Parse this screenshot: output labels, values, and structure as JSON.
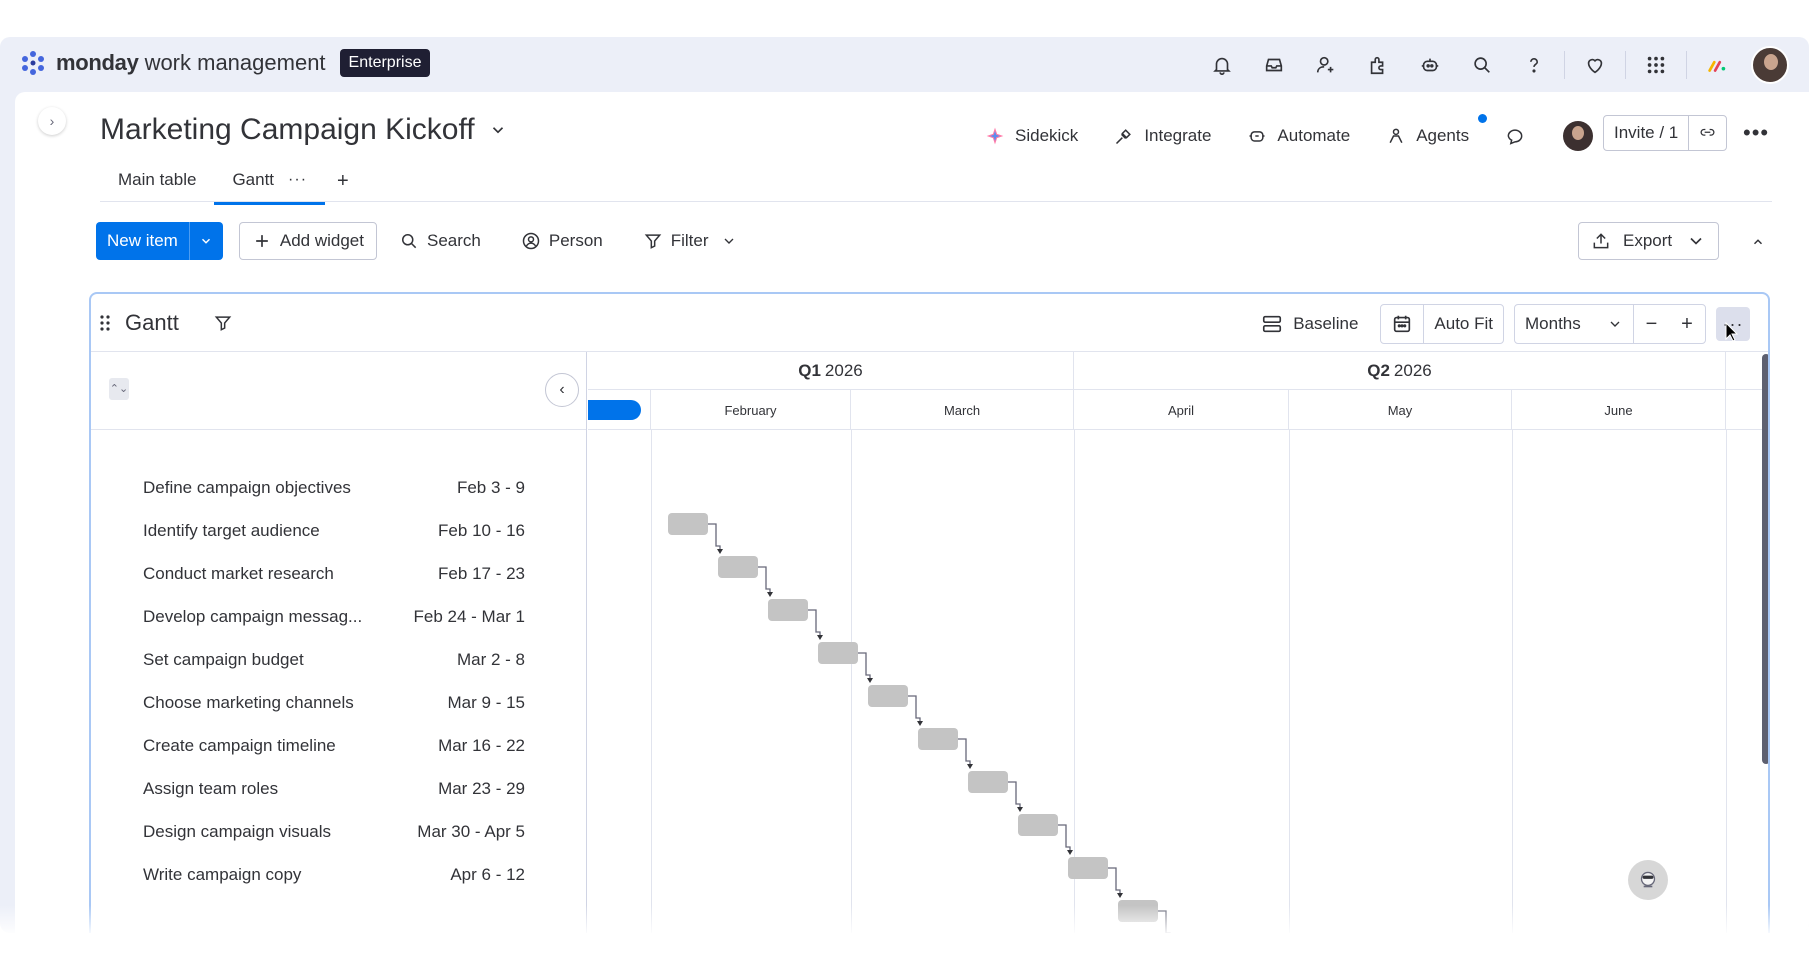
{
  "app": {
    "brand": "monday",
    "product": "work management",
    "plan_badge": "Enterprise",
    "accent": "#0073ea"
  },
  "topbar_icons": [
    "bell-icon",
    "inbox-icon",
    "invite-members-icon",
    "apps-icon",
    "ai-assistant-icon",
    "search-icon",
    "help-icon",
    "heart-icon",
    "apps-grid-icon",
    "monday-products-icon"
  ],
  "board": {
    "title": "Marketing Campaign Kickoff"
  },
  "header_actions": {
    "sidekick": "Sidekick",
    "integrate": "Integrate",
    "automate": "Automate",
    "agents": "Agents",
    "invite": "Invite / 1"
  },
  "tabs": [
    {
      "label": "Main table",
      "active": false
    },
    {
      "label": "Gantt",
      "active": true
    }
  ],
  "tab_more": "···",
  "tab_add": "+",
  "toolbar": {
    "new_item": "New item",
    "add_widget": "Add widget",
    "search": "Search",
    "person": "Person",
    "filter": "Filter",
    "export": "Export"
  },
  "gantt": {
    "title": "Gantt",
    "baseline": "Baseline",
    "auto_fit": "Auto Fit",
    "scale": "Months",
    "zoom_out": "−",
    "zoom_in": "+",
    "more": "···",
    "quarters": [
      {
        "bold": "Q1",
        "year": "2026"
      },
      {
        "bold": "Q2",
        "year": "2026"
      }
    ],
    "months": [
      "February",
      "March",
      "April",
      "May",
      "June"
    ],
    "tasks": [
      {
        "name": "Define campaign objectives",
        "dates": "Feb 3 - 9"
      },
      {
        "name": "Identify target audience",
        "dates": "Feb 10 - 16"
      },
      {
        "name": "Conduct market research",
        "dates": "Feb 17 - 23"
      },
      {
        "name": "Develop campaign messag...",
        "dates": "Feb 24 - Mar 1"
      },
      {
        "name": "Set campaign budget",
        "dates": "Mar 2 - 8"
      },
      {
        "name": "Choose marketing channels",
        "dates": "Mar 9 - 15"
      },
      {
        "name": "Create campaign timeline",
        "dates": "Mar 16 - 22"
      },
      {
        "name": "Assign team roles",
        "dates": "Mar 23 - 29"
      },
      {
        "name": "Design campaign visuals",
        "dates": "Mar 30 - Apr 5"
      },
      {
        "name": "Write campaign copy",
        "dates": "Apr 6 - 12"
      }
    ]
  }
}
